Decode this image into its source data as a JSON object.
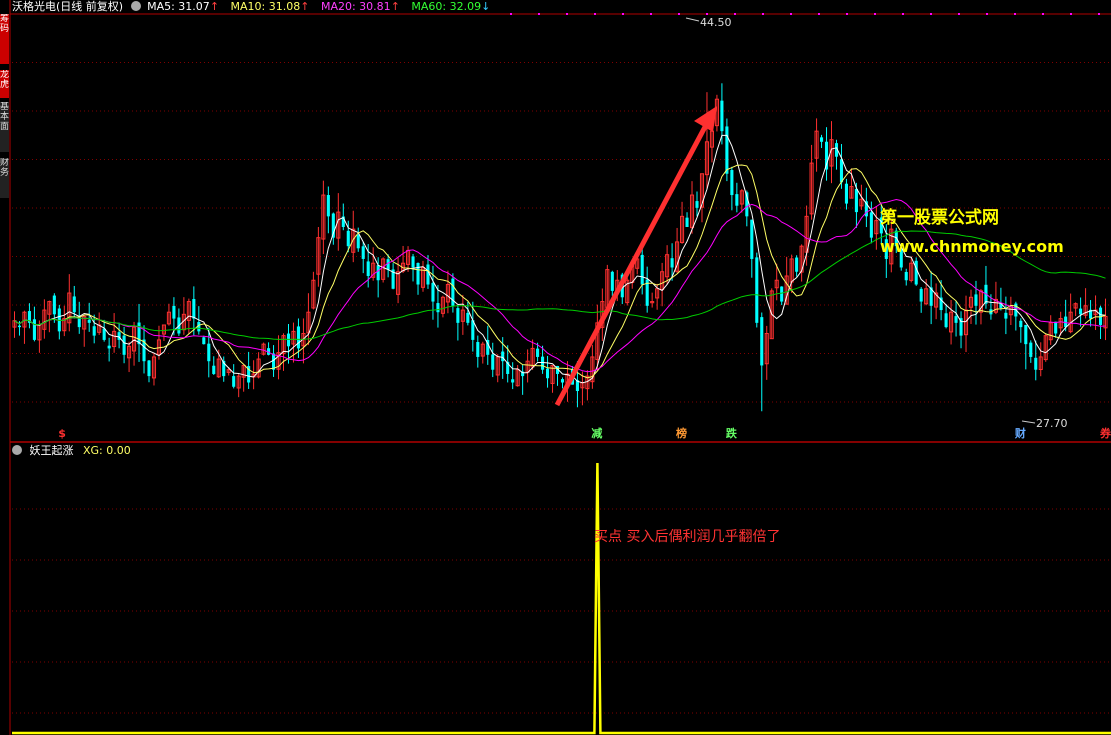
{
  "header": {
    "stock_title": "沃格光电(日线 前复权)",
    "ma5": "MA5: 31.07",
    "ma10": "MA10: 31.08",
    "ma20": "MA20: 30.81",
    "ma60": "MA60: 32.09",
    "arrow_up": "↑",
    "arrow_down": "↓"
  },
  "side_tabs": [
    "筹码",
    "龙虎",
    "基本面",
    "财务"
  ],
  "colors": {
    "up": "#ff3030",
    "down": "#00ffff",
    "ma5": "#ffffff",
    "ma10": "#ffff66",
    "ma20": "#ff00ff",
    "ma60": "#00cc00",
    "grid": "#800000",
    "border": "#b00000",
    "indicator": "#ffff00"
  },
  "chart_data": [
    {
      "type": "candlestick",
      "title": "沃格光电(日线 前复权)",
      "ylim": [
        26.5,
        46.5
      ],
      "high_label": "44.50",
      "low_label": "27.70",
      "markers": [
        {
          "text": "$",
          "color": "#ff3030",
          "index": 10
        },
        {
          "text": "减",
          "color": "#66ff66",
          "index": 117
        },
        {
          "text": "榜",
          "color": "#ff9933",
          "index": 134
        },
        {
          "text": "跌",
          "color": "#66ff66",
          "index": 144
        },
        {
          "text": "财",
          "color": "#66aaff",
          "index": 202
        },
        {
          "text": "券",
          "color": "#ff3030",
          "index": 220
        }
      ],
      "closes": [
        32.1,
        31.8,
        32.5,
        32.0,
        31.2,
        31.9,
        32.6,
        33.0,
        32.4,
        31.6,
        32.2,
        33.4,
        32.5,
        31.8,
        32.3,
        32.0,
        31.4,
        31.9,
        31.2,
        30.8,
        31.6,
        31.2,
        30.5,
        30.9,
        31.8,
        31.0,
        30.2,
        29.5,
        30.4,
        31.2,
        31.9,
        32.5,
        32.2,
        31.5,
        32.4,
        33.0,
        32.2,
        31.6,
        31.0,
        30.2,
        29.6,
        30.3,
        29.5,
        29.8,
        29.0,
        29.5,
        30.0,
        29.2,
        29.6,
        30.3,
        31.0,
        30.5,
        29.8,
        30.6,
        31.4,
        30.9,
        31.6,
        30.8,
        31.5,
        32.5,
        34.0,
        36.0,
        38.0,
        37.0,
        36.0,
        37.2,
        36.5,
        35.6,
        36.4,
        35.5,
        35.0,
        34.2,
        34.8,
        34.0,
        35.0,
        34.5,
        33.6,
        34.4,
        34.8,
        35.4,
        34.6,
        33.8,
        34.6,
        33.8,
        33.0,
        32.5,
        33.2,
        33.8,
        32.8,
        32.0,
        32.6,
        32.0,
        31.2,
        30.4,
        31.0,
        30.5,
        29.8,
        30.4,
        30.2,
        29.6,
        29.2,
        29.8,
        29.5,
        30.2,
        30.8,
        30.4,
        29.8,
        29.4,
        30.0,
        29.6,
        29.2,
        29.6,
        29.1,
        28.8,
        29.2,
        29.5,
        30.4,
        32.0,
        33.0,
        34.5,
        33.5,
        34.0,
        33.2,
        34.0,
        34.8,
        35.0,
        33.8,
        32.8,
        33.0,
        33.6,
        34.4,
        35.2,
        34.6,
        35.8,
        37.0,
        36.5,
        38.0,
        37.4,
        39.0,
        40.5,
        41.0,
        42.5,
        41.0,
        39.0,
        38.0,
        37.5,
        38.2,
        37.0,
        35.0,
        32.0,
        30.0,
        31.5,
        33.5,
        34.0,
        33.0,
        34.2,
        35.0,
        34.4,
        35.6,
        37.0,
        39.5,
        41.0,
        40.5,
        39.2,
        40.6,
        39.8,
        38.6,
        37.6,
        38.4,
        37.2,
        37.8,
        37.0,
        36.0,
        36.8,
        36.2,
        35.0,
        36.4,
        35.6,
        34.6,
        34.0,
        34.8,
        33.8,
        33.0,
        33.6,
        32.8,
        33.4,
        32.6,
        31.8,
        32.5,
        32.0,
        31.4,
        32.6,
        33.2,
        32.8,
        33.5,
        32.9,
        32.4,
        33.1,
        32.7,
        32.2,
        32.8,
        32.3,
        31.8,
        31.0,
        30.4,
        29.8,
        30.4,
        31.4,
        32.0,
        31.5,
        32.2,
        31.8,
        32.5,
        32.9,
        32.4,
        32.8,
        32.2,
        32.6,
        31.9,
        32.3
      ]
    },
    {
      "type": "line",
      "title": "妖王起涨",
      "legend": "XG: 0.00",
      "spike_index": 117,
      "values_note": "XG signal spikes to 1 at the buy point, 0 elsewhere"
    }
  ],
  "annotations": {
    "watermark_line1": "第一股票公式网",
    "watermark_line2": "www.chnmoney.com",
    "buy_note": "买点 买入后偶利润几乎翻倍了"
  }
}
